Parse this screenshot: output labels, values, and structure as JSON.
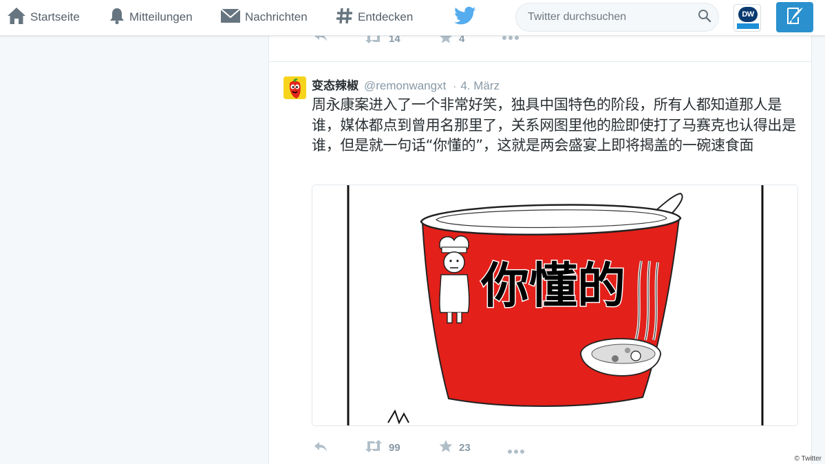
{
  "nav": {
    "home": "Startseite",
    "notifications": "Mitteilungen",
    "messages": "Nachrichten",
    "discover": "Entdecken"
  },
  "search": {
    "placeholder": "Twitter durchsuchen"
  },
  "profile_avatar": {
    "logo_text": "DW"
  },
  "previous_tweet": {
    "retweets": "14",
    "likes": "4"
  },
  "tweet": {
    "fullname": "变态辣椒",
    "username": "@remonwangxt",
    "separator": "·",
    "date": "4. März",
    "text": "周永康案进入了一个非常好笑，独具中国特色的阶段，所有人都知道那人是谁，媒体都点到曾用名那里了，关系网图里他的脸即使打了马赛克也认得出是谁，但是就一句话“你懂的”，这就是两会盛宴上即将揭盖的一碗速食面",
    "image_caption": "你懂的",
    "retweets": "99",
    "likes": "23"
  },
  "credit": "© Twitter",
  "colors": {
    "twitter_blue": "#55acee",
    "compose_blue": "#2a91ce",
    "cup_red": "#e3201a"
  }
}
